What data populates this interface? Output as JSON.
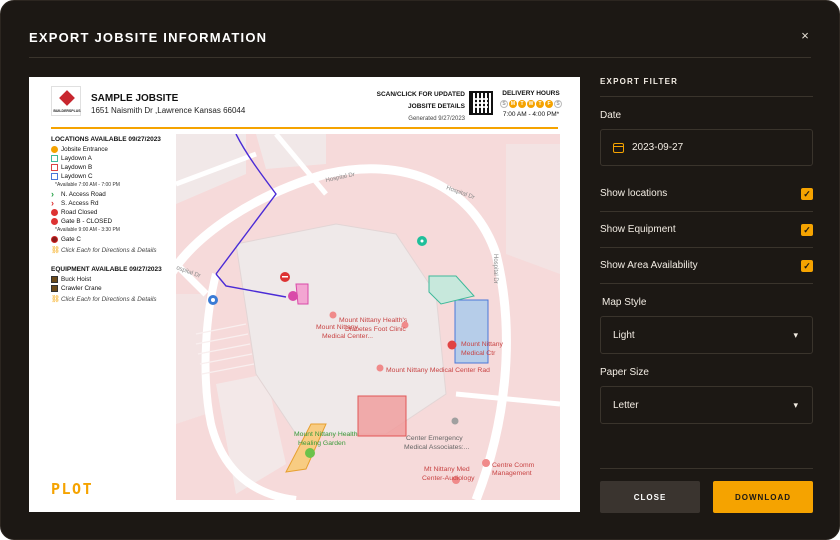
{
  "dialog": {
    "title": "EXPORT JOBSITE INFORMATION",
    "close_glyph": "×"
  },
  "sheet": {
    "site_name": "SAMPLE JOBSITE",
    "address": "1651 Naismith Dr ,Lawrence Kansas 66044",
    "logo_text": "BUILDERSPLUS",
    "scan_line1": "SCAN/CLICK FOR UPDATED",
    "scan_line2": "JOBSITE DETAILS",
    "generated": "Generated 9/27/2023",
    "delivery_title": "DELIVERY HOURS",
    "delivery_days": [
      {
        "letter": "S",
        "on": false
      },
      {
        "letter": "M",
        "on": true
      },
      {
        "letter": "T",
        "on": true
      },
      {
        "letter": "W",
        "on": true
      },
      {
        "letter": "T",
        "on": true
      },
      {
        "letter": "F",
        "on": true
      },
      {
        "letter": "S",
        "on": false
      }
    ],
    "delivery_hours": "7:00 AM - 4:00 PM*",
    "locations_title": "LOCATIONS AVAILABLE 09/27/2023",
    "locations": [
      {
        "label": "Jobsite Entrance",
        "icon": "entrance-icon",
        "color": "#f5a300"
      },
      {
        "label": "Laydown A",
        "icon": "laydown-a-icon",
        "color": "#3fb99a"
      },
      {
        "label": "Laydown B",
        "icon": "laydown-b-icon",
        "color": "#d44"
      },
      {
        "label": "Laydown C",
        "icon": "laydown-c-icon",
        "color": "#4a78d8"
      }
    ],
    "note_1": "*Available 7:00 AM - 7:00 PM",
    "roads": [
      {
        "label": "N. Access Road",
        "icon": "chevron-green-icon",
        "color": "#2aa34a"
      },
      {
        "label": "S. Access Rd",
        "icon": "chevron-red-icon",
        "color": "#d33"
      },
      {
        "label": "Road Closed",
        "icon": "road-closed-icon",
        "color": "#d33"
      },
      {
        "label": "Gate B - CLOSED",
        "icon": "gate-closed-icon",
        "color": "#d33"
      }
    ],
    "note_2": "*Available 9:00 AM - 3:30 PM",
    "gate_c": "Gate C",
    "cta": "Click Each for Directions & Details",
    "equipment_title": "EQUIPMENT AVAILABLE 09/27/2023",
    "equipment": [
      {
        "label": "Buck Hoist",
        "icon": "hoist-icon"
      },
      {
        "label": "Crawler Crane",
        "icon": "crane-icon"
      }
    ],
    "cta_2": "Click Each for Directions & Details",
    "brand": "PLOT"
  },
  "map_labels": {
    "diabetes": [
      "Mount Nittany Health's",
      "Diabetes Foot Clinic"
    ],
    "med_center_rad": "Mount Nittany Medical Center Rad",
    "med_center": [
      "Mount Nittany",
      "Medical Center..."
    ],
    "med_ctr": [
      "Mount Nittany",
      "Medical Ctr"
    ],
    "healing": [
      "Mount Nittany Health",
      "Healing Garden"
    ],
    "emergency": [
      "Center Emergency",
      "Medical Associates:..."
    ],
    "audiology": [
      "Mt Nittany Med",
      "Center-Audiology"
    ],
    "centre_comm": [
      "Centre Comm",
      "Management"
    ],
    "hospital_dr_top": "Hospital Dr",
    "hospital_dr_right": "Hospital Dr",
    "hospital_dr_left": "Hospital Dr",
    "hospital_dr_far": "ospital Dr"
  },
  "panel": {
    "heading": "EXPORT FILTER",
    "date_label": "Date",
    "date_value": "2023-09-27",
    "toggles": [
      {
        "label": "Show locations",
        "checked": true
      },
      {
        "label": "Show Equipment",
        "checked": true
      },
      {
        "label": "Show Area Availability",
        "checked": true
      }
    ],
    "map_style_label": "Map Style",
    "map_style_value": "Light",
    "paper_size_label": "Paper Size",
    "paper_size_value": "Letter",
    "caret": "▾",
    "check_glyph": "✓"
  },
  "buttons": {
    "close": "CLOSE",
    "download": "DOWNLOAD"
  },
  "colors": {
    "accent": "#f5a300",
    "background": "#1c1814",
    "map_pink": "#f6dada"
  }
}
